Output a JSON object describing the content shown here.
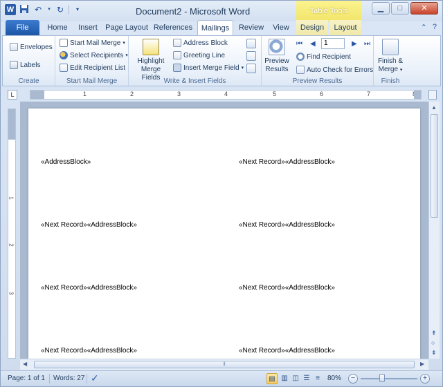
{
  "app": {
    "window_title": "Document2 - Microsoft Word",
    "context_tools": "Table Tools",
    "logo_letter": "W"
  },
  "qat": {
    "save_icon": "save-icon",
    "undo_icon": "undo-icon",
    "redo_icon": "redo-icon"
  },
  "window_controls": {
    "minimize": "▁",
    "maximize": "□",
    "close": "✕"
  },
  "tabs": [
    {
      "label": "File"
    },
    {
      "label": "Home"
    },
    {
      "label": "Insert"
    },
    {
      "label": "Page Layout"
    },
    {
      "label": "References"
    },
    {
      "label": "Mailings"
    },
    {
      "label": "Review"
    },
    {
      "label": "View"
    },
    {
      "label": "Design"
    },
    {
      "label": "Layout"
    }
  ],
  "ribbon": {
    "create": {
      "label": "Create",
      "envelopes": "Envelopes",
      "labels": "Labels"
    },
    "start_mail_merge": {
      "label": "Start Mail Merge",
      "start": "Start Mail Merge",
      "select_recipients": "Select Recipients",
      "edit_recipient_list": "Edit Recipient List"
    },
    "write_insert": {
      "label": "Write & Insert Fields",
      "highlight_line1": "Highlight",
      "highlight_line2": "Merge Fields",
      "address_block": "Address Block",
      "greeting_line": "Greeting Line",
      "insert_merge_field": "Insert Merge Field"
    },
    "preview": {
      "label": "Preview Results",
      "preview_line1": "Preview",
      "preview_line2": "Results",
      "record_value": "1",
      "find_recipient": "Find Recipient",
      "auto_check": "Auto Check for Errors"
    },
    "finish": {
      "label": "Finish",
      "finish_line1": "Finish &",
      "finish_line2": "Merge"
    }
  },
  "ruler": {
    "corner": "L",
    "numbers": [
      "1",
      "2",
      "3",
      "4",
      "5",
      "6",
      "7",
      "8"
    ],
    "vnumbers": [
      "1",
      "2",
      "3"
    ]
  },
  "document": {
    "labels": [
      "«AddressBlock»",
      "«Next Record»«AddressBlock»",
      "«Next Record»«AddressBlock»",
      "«Next Record»«AddressBlock»",
      "«Next Record»«AddressBlock»",
      "«Next Record»«AddressBlock»",
      "«Next Record»«AddressBlock»",
      "«Next Record»«AddressBlock»"
    ]
  },
  "status": {
    "page": "Page: 1 of 1",
    "words": "Words: 27",
    "zoom": "80%"
  }
}
